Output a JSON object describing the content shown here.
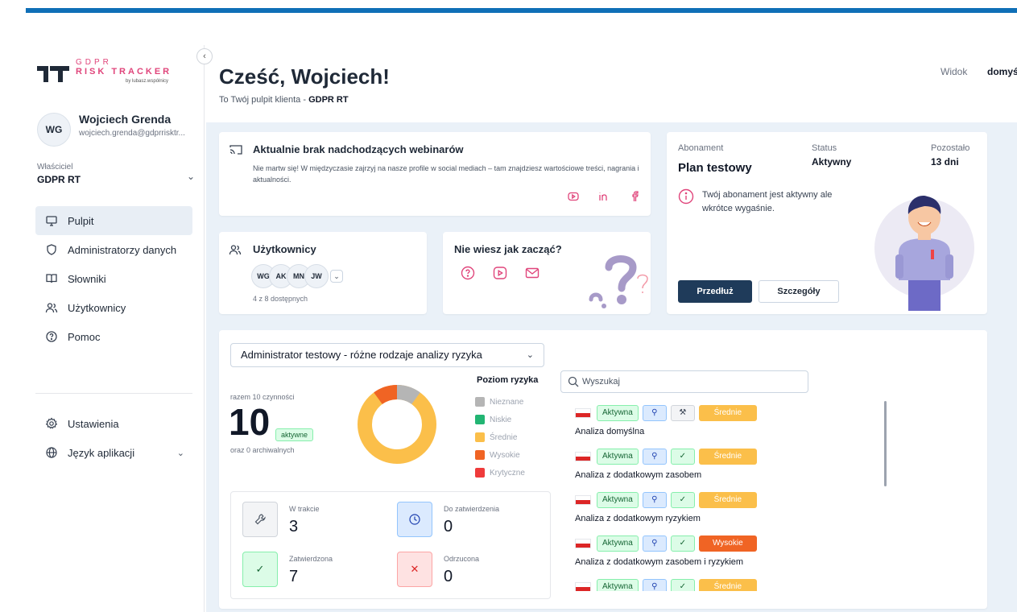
{
  "logo": {
    "line1": "GDPR",
    "line2": "RISK TRACKER",
    "line3": "by lubasz.wspólnicy"
  },
  "user": {
    "initials": "WG",
    "name": "Wojciech Grenda",
    "email": "wojciech.grenda@gdprrisktr..."
  },
  "owner": {
    "label": "Właściciel",
    "value": "GDPR RT"
  },
  "nav": {
    "items": [
      {
        "label": "Pulpit",
        "icon": "monitor-icon"
      },
      {
        "label": "Administratorzy danych",
        "icon": "shield-icon"
      },
      {
        "label": "Słowniki",
        "icon": "book-icon"
      },
      {
        "label": "Użytkownicy",
        "icon": "users-icon"
      },
      {
        "label": "Pomoc",
        "icon": "help-icon"
      }
    ],
    "settings": "Ustawienia",
    "language": "Język aplikacji"
  },
  "header": {
    "greeting": "Cześć, Wojciech!",
    "subtitle_prefix": "To Twój pulpit klienta - ",
    "subtitle_bold": "GDPR RT",
    "view_label": "Widok",
    "view_value": "domyśl"
  },
  "webinar": {
    "title": "Aktualnie brak nadchodzących webinarów",
    "desc": "Nie martw się! W międzyczasie zajrzyj na nasze profile w social mediach – tam znajdziesz wartościowe treści, nagrania i aktualności."
  },
  "users_card": {
    "title": "Użytkownicy",
    "avatars": [
      "WG",
      "AK",
      "MN",
      "JW"
    ],
    "count": "4 z 8 dostępnych"
  },
  "help_card": {
    "title": "Nie wiesz jak zacząć?"
  },
  "subscription": {
    "label_sub": "Abonament",
    "plan": "Plan testowy",
    "label_status": "Status",
    "status": "Aktywny",
    "label_remaining": "Pozostało",
    "remaining": "13 dni",
    "note": "Twój abonament jest aktywny ale wkrótce wygaśnie.",
    "btn_extend": "Przedłuż",
    "btn_details": "Szczegóły"
  },
  "analysis": {
    "admin_select": "Administrator testowy - różne rodzaje analizy ryzyka",
    "total_label": "razem 10 czynności",
    "total": "10",
    "active_badge": "aktywne",
    "archived": "oraz 0 archiwalnych",
    "legend_title": "Poziom ryzyka",
    "legend": [
      {
        "label": "Nieznane",
        "color": "#b5b5b5"
      },
      {
        "label": "Niskie",
        "color": "#22b573"
      },
      {
        "label": "Średnie",
        "color": "#fbbf4a"
      },
      {
        "label": "Wysokie",
        "color": "#f06424"
      },
      {
        "label": "Krytyczne",
        "color": "#ef3b3b"
      }
    ],
    "status": {
      "in_progress_label": "W trakcie",
      "in_progress": "3",
      "to_approve_label": "Do zatwierdzenia",
      "to_approve": "0",
      "approved_label": "Zatwierdzona",
      "approved": "7",
      "rejected_label": "Odrzucona",
      "rejected": "0"
    },
    "search_placeholder": "Wyszukaj",
    "items": [
      {
        "status": "Aktywna",
        "level": "Średnie",
        "level_color": "#fbbf4a",
        "name": "Analiza domyślna",
        "second": "wrench"
      },
      {
        "status": "Aktywna",
        "level": "Średnie",
        "level_color": "#fbbf4a",
        "name": "Analiza z dodatkowym zasobem",
        "second": "check"
      },
      {
        "status": "Aktywna",
        "level": "Średnie",
        "level_color": "#fbbf4a",
        "name": "Analiza z dodatkowym ryzykiem",
        "second": "check"
      },
      {
        "status": "Aktywna",
        "level": "Wysokie",
        "level_color": "#f06424",
        "name": "Analiza z dodatkowym zasobem i ryzykiem",
        "second": "check"
      },
      {
        "status": "Aktywna",
        "level": "Średnie",
        "level_color": "#fbbf4a",
        "name": "",
        "second": "check"
      }
    ]
  }
}
